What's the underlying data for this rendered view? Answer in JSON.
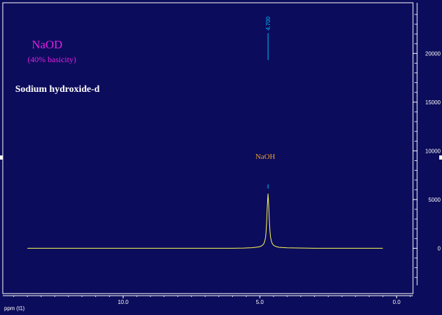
{
  "title": "NaOD",
  "subtitle": "(40% basicity)",
  "compound": "Sodium hydroxide-d",
  "colors": {
    "background": "#0c0c5c",
    "frame": "#ffffff",
    "spectrum": "#ffff55",
    "peak_label": "#00bfff",
    "title": "#e020e0",
    "compound": "#ffffff",
    "annotation": "#e8a030"
  },
  "chart_data": {
    "type": "line",
    "xlabel": "ppm (t1)",
    "xlim": [
      14.4,
      -0.6
    ],
    "ylim": [
      -3800,
      25200
    ],
    "x_ticks": [
      10.0,
      5.0,
      0.0
    ],
    "x_tick_labels": [
      "10.0",
      "5.0",
      "0.0"
    ],
    "y_ticks": [
      0,
      5000,
      10000,
      15000,
      20000
    ],
    "y_tick_labels": [
      "0",
      "5000",
      "10000",
      "15000",
      "20000"
    ],
    "series": [
      {
        "x": [
          13.5,
          6.0,
          5.6,
          5.3,
          5.1,
          5.0,
          4.95,
          4.9,
          4.85,
          4.82,
          4.79,
          4.77,
          4.75,
          4.73,
          4.7,
          4.67,
          4.65,
          4.63,
          4.61,
          4.58,
          4.55,
          4.5,
          4.45,
          4.4,
          4.3,
          4.0,
          3.0,
          0.5
        ],
        "y": [
          0,
          0,
          20,
          60,
          120,
          170,
          230,
          320,
          500,
          750,
          1150,
          1750,
          2700,
          4100,
          5600,
          4100,
          2700,
          1750,
          1150,
          750,
          500,
          320,
          230,
          170,
          100,
          40,
          0,
          0
        ]
      }
    ],
    "peak_labels": [
      {
        "x": 4.7,
        "label": "4.700"
      }
    ],
    "annotations": [
      {
        "x": 4.7,
        "text": "NaOH"
      }
    ],
    "grid": false
  }
}
